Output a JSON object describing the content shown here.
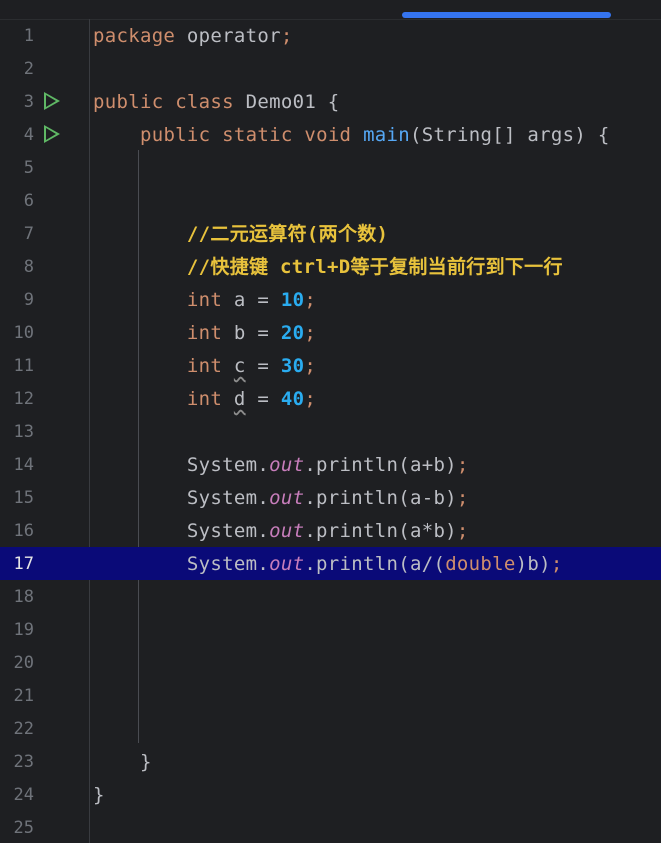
{
  "editor": {
    "lines": [
      {
        "num": "1",
        "tokens": [
          {
            "t": "package",
            "c": "kw"
          },
          {
            "t": " operator",
            "c": ""
          },
          {
            "t": ";",
            "c": "kw"
          }
        ]
      },
      {
        "num": "2",
        "tokens": []
      },
      {
        "num": "3",
        "run": true,
        "tokens": [
          {
            "t": "public",
            "c": "kw"
          },
          {
            "t": " ",
            "c": ""
          },
          {
            "t": "class",
            "c": "kw"
          },
          {
            "t": " Demo01 {",
            "c": ""
          }
        ]
      },
      {
        "num": "4",
        "run": true,
        "tokens": [
          {
            "t": "    ",
            "c": ""
          },
          {
            "t": "public",
            "c": "kw"
          },
          {
            "t": " ",
            "c": ""
          },
          {
            "t": "static",
            "c": "kw"
          },
          {
            "t": " ",
            "c": ""
          },
          {
            "t": "void",
            "c": "kw"
          },
          {
            "t": " ",
            "c": ""
          },
          {
            "t": "main",
            "c": "fn"
          },
          {
            "t": "(String[] args) {",
            "c": ""
          }
        ]
      },
      {
        "num": "5",
        "tokens": []
      },
      {
        "num": "6",
        "tokens": []
      },
      {
        "num": "7",
        "tokens": [
          {
            "t": "        ",
            "c": ""
          },
          {
            "t": "//二元运算符(两个数)",
            "c": "cmt"
          }
        ]
      },
      {
        "num": "8",
        "tokens": [
          {
            "t": "        ",
            "c": ""
          },
          {
            "t": "//快捷键 ctrl+D等于复制当前行到下一行",
            "c": "cmt"
          }
        ]
      },
      {
        "num": "9",
        "tokens": [
          {
            "t": "        ",
            "c": ""
          },
          {
            "t": "int",
            "c": "kw"
          },
          {
            "t": " a = ",
            "c": ""
          },
          {
            "t": "10",
            "c": "num"
          },
          {
            "t": ";",
            "c": "kw"
          }
        ]
      },
      {
        "num": "10",
        "tokens": [
          {
            "t": "        ",
            "c": ""
          },
          {
            "t": "int",
            "c": "kw"
          },
          {
            "t": " b = ",
            "c": ""
          },
          {
            "t": "20",
            "c": "num"
          },
          {
            "t": ";",
            "c": "kw"
          }
        ]
      },
      {
        "num": "11",
        "tokens": [
          {
            "t": "        ",
            "c": ""
          },
          {
            "t": "int",
            "c": "kw"
          },
          {
            "t": " ",
            "c": ""
          },
          {
            "t": "c",
            "c": "sq"
          },
          {
            "t": " = ",
            "c": ""
          },
          {
            "t": "30",
            "c": "num"
          },
          {
            "t": ";",
            "c": "kw"
          }
        ]
      },
      {
        "num": "12",
        "tokens": [
          {
            "t": "        ",
            "c": ""
          },
          {
            "t": "int",
            "c": "kw"
          },
          {
            "t": " ",
            "c": ""
          },
          {
            "t": "d",
            "c": "sq"
          },
          {
            "t": " = ",
            "c": ""
          },
          {
            "t": "40",
            "c": "num"
          },
          {
            "t": ";",
            "c": "kw"
          }
        ]
      },
      {
        "num": "13",
        "tokens": []
      },
      {
        "num": "14",
        "tokens": [
          {
            "t": "        System.",
            "c": ""
          },
          {
            "t": "out",
            "c": "fld"
          },
          {
            "t": ".println(a+b)",
            "c": ""
          },
          {
            "t": ";",
            "c": "kw"
          }
        ]
      },
      {
        "num": "15",
        "tokens": [
          {
            "t": "        System.",
            "c": ""
          },
          {
            "t": "out",
            "c": "fld"
          },
          {
            "t": ".println(a-b)",
            "c": ""
          },
          {
            "t": ";",
            "c": "kw"
          }
        ]
      },
      {
        "num": "16",
        "tokens": [
          {
            "t": "        System.",
            "c": ""
          },
          {
            "t": "out",
            "c": "fld"
          },
          {
            "t": ".println(a*b)",
            "c": ""
          },
          {
            "t": ";",
            "c": "kw"
          }
        ]
      },
      {
        "num": "17",
        "current": true,
        "tokens": [
          {
            "t": "        System.",
            "c": ""
          },
          {
            "t": "out",
            "c": "fld"
          },
          {
            "t": ".println(a/(",
            "c": ""
          },
          {
            "t": "double",
            "c": "kw"
          },
          {
            "t": ")b)",
            "c": ""
          },
          {
            "t": ";",
            "c": "kw"
          }
        ]
      },
      {
        "num": "18",
        "tokens": []
      },
      {
        "num": "19",
        "tokens": []
      },
      {
        "num": "20",
        "tokens": []
      },
      {
        "num": "21",
        "tokens": []
      },
      {
        "num": "22",
        "tokens": []
      },
      {
        "num": "23",
        "tokens": [
          {
            "t": "    }",
            "c": ""
          }
        ]
      },
      {
        "num": "24",
        "tokens": [
          {
            "t": "}",
            "c": ""
          }
        ]
      },
      {
        "num": "25",
        "tokens": []
      }
    ]
  },
  "colors": {
    "background": "#1e1f22",
    "keyword": "#cf8e6d",
    "number": "#2aacf0",
    "comment": "#e8c23c",
    "static_field": "#c77dbb",
    "method": "#56a8f5",
    "current_line": "#0a0a78",
    "run_icon": "#5fb865",
    "scroll_thumb": "#3574f0"
  },
  "icons": {
    "run": "run-gutter-icon"
  }
}
